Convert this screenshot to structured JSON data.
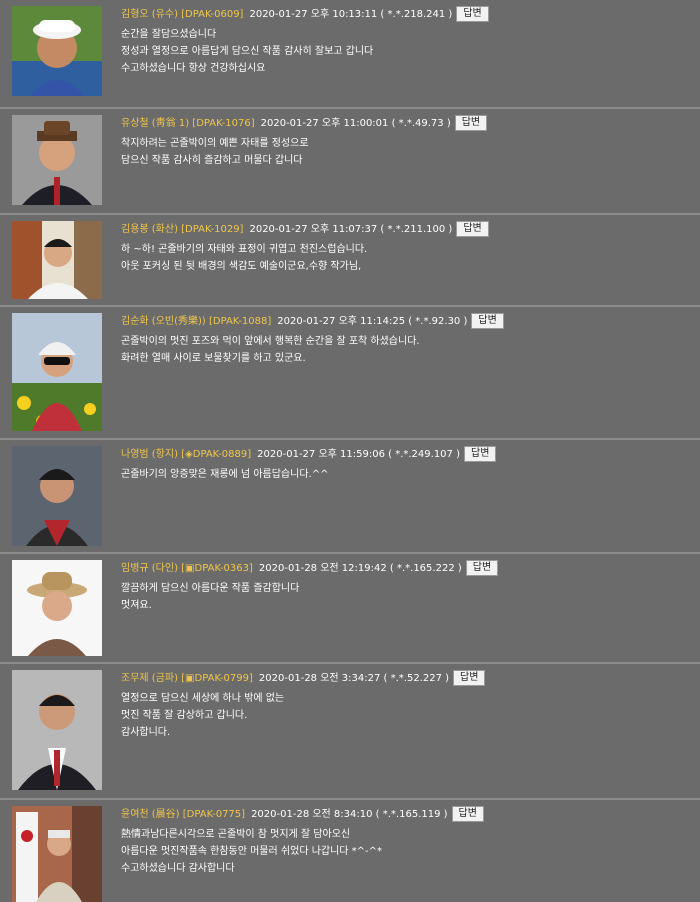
{
  "comments": [
    {
      "author": "김형오 (유수) [DPAK-0609]",
      "date": "2020-01-27 오후 10:13:11 ( *.*.218.241 )",
      "reply": "답변",
      "lines": [
        "순간을 잘담으셨습니다",
        "정성과 열정으로 아름답게 담으신 작품 감사히 잘보고 갑니다",
        "수고하셨습니다 항상 건강하십시요"
      ]
    },
    {
      "author": "유상철 (靑翁 1) [DPAK-1076]",
      "date": "2020-01-27 오후 11:00:01 ( *.*.49.73 )",
      "reply": "답변",
      "lines": [
        "착지하려는 곤줄박이의 예쁜 자태를 정성으로",
        "담으신 작품 감사히 즐감하고 머물다 갑니다"
      ]
    },
    {
      "author": "김용봉 (화산) [DPAK-1029]",
      "date": "2020-01-27 오후 11:07:37 ( *.*.211.100 )",
      "reply": "답변",
      "lines": [
        "하 ~하! 곤줄바기의 자태와 표정이 귀엽고 천진스럽습니다.",
        "아웃 포커싱 된  뒷 배경의 색감도 예술이군요,수향 작가님,"
      ]
    },
    {
      "author": "김순화 (오빈(秀樂)) [DPAK-1088]",
      "date": "2020-01-27 오후 11:14:25 ( *.*.92.30 )",
      "reply": "답변",
      "lines": [
        "곤줄박이의 멋진 포즈와 먹이 앞에서 행복한 순간을 잘 포착 하셨습니다.",
        "화려한 열매 사이로 보물찾기를 하고 있군요."
      ]
    },
    {
      "author": "나영범 (항지) [◈DPAK-0889]",
      "date": "2020-01-27 오후 11:59:06 ( *.*.249.107 )",
      "reply": "답변",
      "lines": [
        "곤줄바기의 앙증맞은 재롱에 넘 아름답습니다.^^"
      ]
    },
    {
      "author": "임병규 (다인) [▣DPAK-0363]",
      "date": "2020-01-28 오전 12:19:42 ( *.*.165.222 )",
      "reply": "답변",
      "lines": [
        "깔끔하게 담으신 아름다운 작품 즐감합니다",
        "멋져요."
      ]
    },
    {
      "author": "조무제 (금파) [▣DPAK-0799]",
      "date": "2020-01-28 오전 3:34:27 ( *.*.52.227 )",
      "reply": "답변",
      "lines": [
        "열정으로 담으신 세상에 하나 밖에 없는",
        "멋진 작품 잘 감상하고 갑니다.",
        "감사합니다."
      ]
    },
    {
      "author": "윤여천 (晨谷) [DPAK-0775]",
      "date": "2020-01-28 오전 8:34:10 ( *.*.165.119 )",
      "reply": "답변",
      "lines": [
        " 熱情과남다른시각으로 곤줄박이 참 멋지게 잘 담아오신",
        "아름다운 멋진작품속 한참동안 머물러 쉬었다 나갑니다 *^-^*",
        "수고하셨습니다  감사합니다"
      ]
    }
  ]
}
